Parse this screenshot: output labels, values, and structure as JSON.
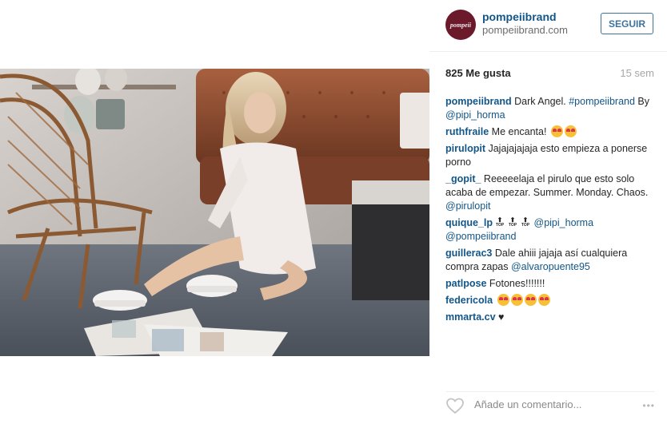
{
  "post": {
    "image_alt": "Photo of a woman in a white shirt sitting on the floor beside a wicker chair and a leather sofa, with magazines around her"
  },
  "header": {
    "avatar_text": "pompeii",
    "username": "pompeiibrand",
    "subtitle": "pompeiibrand.com",
    "follow_label": "SEGUIR"
  },
  "stats": {
    "likes": "825 Me gusta",
    "time": "15 sem"
  },
  "comments": [
    {
      "user": "pompeiibrand",
      "parts": [
        {
          "t": "text",
          "v": " Dark Angel. "
        },
        {
          "t": "mention",
          "v": "#pompeiibrand"
        },
        {
          "t": "text",
          "v": " By "
        },
        {
          "t": "mention",
          "v": "@pipi_horma"
        }
      ]
    },
    {
      "user": "ruthfraile",
      "parts": [
        {
          "t": "text",
          "v": " Me encanta! "
        },
        {
          "t": "emoji",
          "v": "heart-eyes-emoji"
        },
        {
          "t": "emoji",
          "v": "heart-eyes-emoji"
        }
      ]
    },
    {
      "user": "pirulopit",
      "parts": [
        {
          "t": "text",
          "v": " Jajajajajaja esto empieza a ponerse porno"
        }
      ]
    },
    {
      "user": "_gopit_",
      "parts": [
        {
          "t": "text",
          "v": " Reeeeelaja el pirulo que esto solo acaba de empezar. Summer. Monday. Chaos. "
        },
        {
          "t": "mention",
          "v": "@pirulopit"
        }
      ]
    },
    {
      "user": "quique_lp",
      "parts": [
        {
          "t": "top",
          "v": "TOP"
        },
        {
          "t": "top",
          "v": "TOP"
        },
        {
          "t": "top",
          "v": "TOP"
        },
        {
          "t": "text",
          "v": " "
        },
        {
          "t": "mention",
          "v": "@pipi_horma"
        },
        {
          "t": "text",
          "v": " "
        },
        {
          "t": "mention",
          "v": "@pompeiibrand"
        }
      ]
    },
    {
      "user": "guillerac3",
      "parts": [
        {
          "t": "text",
          "v": " Dale ahiii jajaja así cualquiera compra zapas "
        },
        {
          "t": "mention",
          "v": "@alvaropuente95"
        }
      ]
    },
    {
      "user": "patlpose",
      "parts": [
        {
          "t": "text",
          "v": " Fotones!!!!!!!"
        }
      ]
    },
    {
      "user": "federicola",
      "parts": [
        {
          "t": "text",
          "v": " "
        },
        {
          "t": "emoji",
          "v": "heart-eyes-emoji"
        },
        {
          "t": "emoji",
          "v": "heart-eyes-emoji"
        },
        {
          "t": "emoji",
          "v": "heart-eyes-emoji"
        },
        {
          "t": "emoji",
          "v": "heart-eyes-emoji"
        }
      ]
    },
    {
      "user": "mmarta.cv",
      "parts": [
        {
          "t": "text",
          "v": " ♥"
        }
      ]
    }
  ],
  "footer": {
    "comment_placeholder": "Añade un comentario...",
    "more_label": "•••"
  },
  "colors": {
    "link": "#125688",
    "follow": "#3f729b",
    "avatar_bg": "#6b1a2b"
  },
  "icons": [
    "heart-icon",
    "more-options-icon",
    "heart-eyes-emoji",
    "top-arrow-icon"
  ]
}
